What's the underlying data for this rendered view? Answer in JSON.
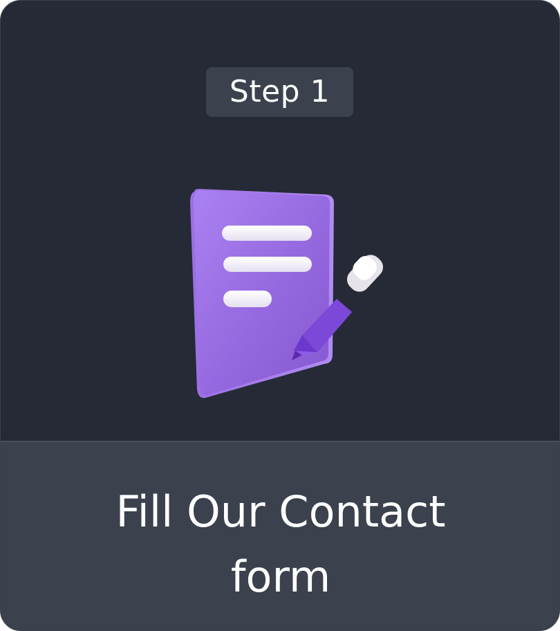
{
  "card": {
    "step_label": "Step 1",
    "title": "Fill Our Contact\nform",
    "icon": "contact-form-with-pencil-icon"
  },
  "colors": {
    "card_background": "#252a36",
    "footer_background": "#3b414d",
    "badge_background": "#3b424e",
    "accent_purple": "#8f63d6",
    "text": "#ffffff"
  }
}
